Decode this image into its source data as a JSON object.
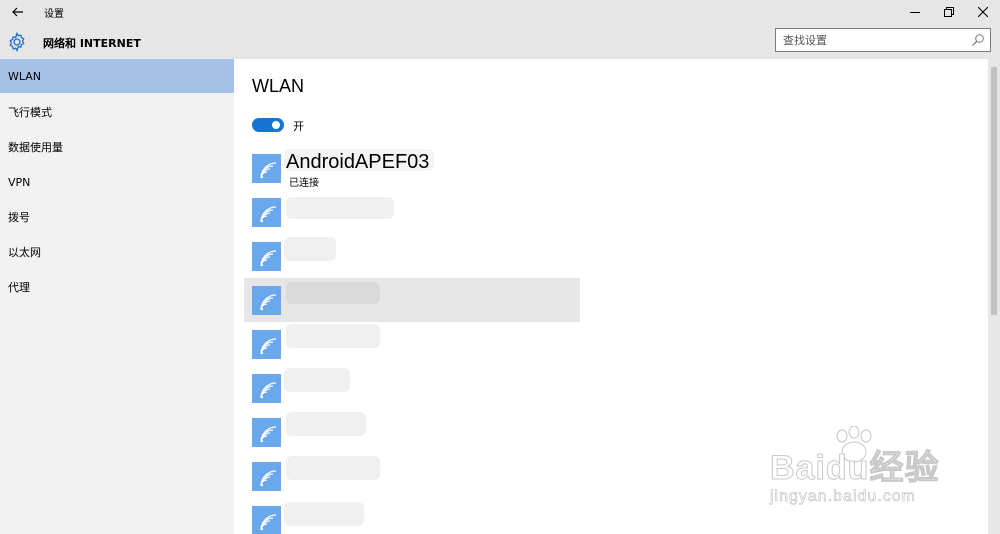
{
  "window": {
    "title": "设置",
    "back_icon": "back-arrow-icon",
    "controls": [
      "minimize-icon",
      "restore-icon",
      "close-icon"
    ]
  },
  "header": {
    "icon": "gear-icon",
    "title": "网络和 INTERNET",
    "search_placeholder": "查找设置",
    "search_icon": "search-icon"
  },
  "sidebar": {
    "items": [
      {
        "label": "WLAN",
        "selected": true
      },
      {
        "label": "飞行模式"
      },
      {
        "label": "数据使用量"
      },
      {
        "label": "VPN"
      },
      {
        "label": "拨号"
      },
      {
        "label": "以太网"
      },
      {
        "label": "代理"
      }
    ]
  },
  "main": {
    "title": "WLAN",
    "toggle": {
      "label": "开",
      "on": true
    },
    "networks": [
      {
        "name": "AndroidAPEF03",
        "status": "已连接",
        "icon": "wifi-signal-icon"
      }
    ]
  },
  "colors": {
    "accent": "#1874d2",
    "selected": "#a5c2e6",
    "wifi_tile": "#6aa8ed"
  },
  "watermark": {
    "brand": "Baidu经验",
    "url": "jingyan.baidu.com"
  }
}
